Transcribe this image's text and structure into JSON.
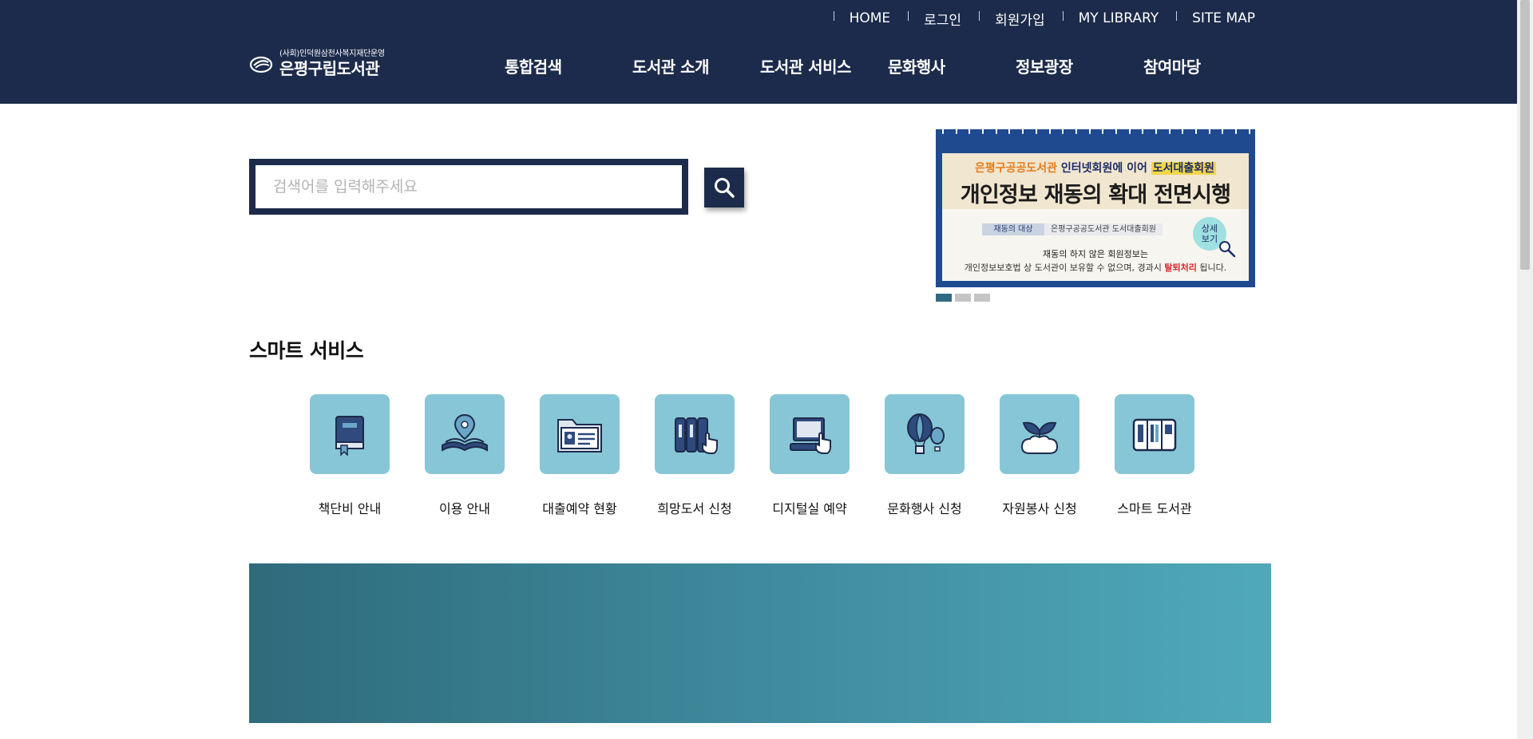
{
  "header": {
    "util_links": [
      "HOME",
      "로그인",
      "회원가입",
      "MY LIBRARY",
      "SITE MAP"
    ],
    "logo": {
      "sub": "(사회)인덕원삼천사복지재단운영",
      "main": "은평구립도서관"
    },
    "menu": [
      "통합검색",
      "도서관 소개",
      "도서관 서비스",
      "문화행사",
      "정보광장",
      "참여마당"
    ]
  },
  "search": {
    "placeholder": "검색어를 입력해주세요",
    "value": ""
  },
  "banner": {
    "line1_a": "은평구공공도서관",
    "line1_b": "인터넷회원에 이어",
    "line1_c": "도서대출회원",
    "title": "개인정보 재동의 확대 전면시행",
    "table_head": "재동의 대상",
    "table_value": "은평구공공도서관 도서대출회원",
    "line3": "재동의 하지 않은 회원정보는",
    "line4_a": "개인정보보호법 상 도서관이 보유할 수 없으며, 경과시",
    "line4_b": "탈퇴처리",
    "line4_c": "됩니다.",
    "detail_1": "상세",
    "detail_2": "보기",
    "slide_count": 3,
    "active_slide": 1
  },
  "smart_service": {
    "title": "스마트 서비스",
    "items": [
      {
        "label": "책단비 안내",
        "icon": "book-icon"
      },
      {
        "label": "이용 안내",
        "icon": "open-book-pin-icon"
      },
      {
        "label": "대출예약 현황",
        "icon": "folder-card-icon"
      },
      {
        "label": "희망도서 신청",
        "icon": "books-hand-icon"
      },
      {
        "label": "디지털실 예약",
        "icon": "computer-icon"
      },
      {
        "label": "문화행사 신청",
        "icon": "balloon-icon"
      },
      {
        "label": "자원봉사 신청",
        "icon": "sprout-hands-icon"
      },
      {
        "label": "스마트 도서관",
        "icon": "kiosk-icon"
      }
    ]
  },
  "colors": {
    "navy": "#1c2b4b",
    "icon_bg": "#87c6d6",
    "accent": "#2e6b82"
  }
}
